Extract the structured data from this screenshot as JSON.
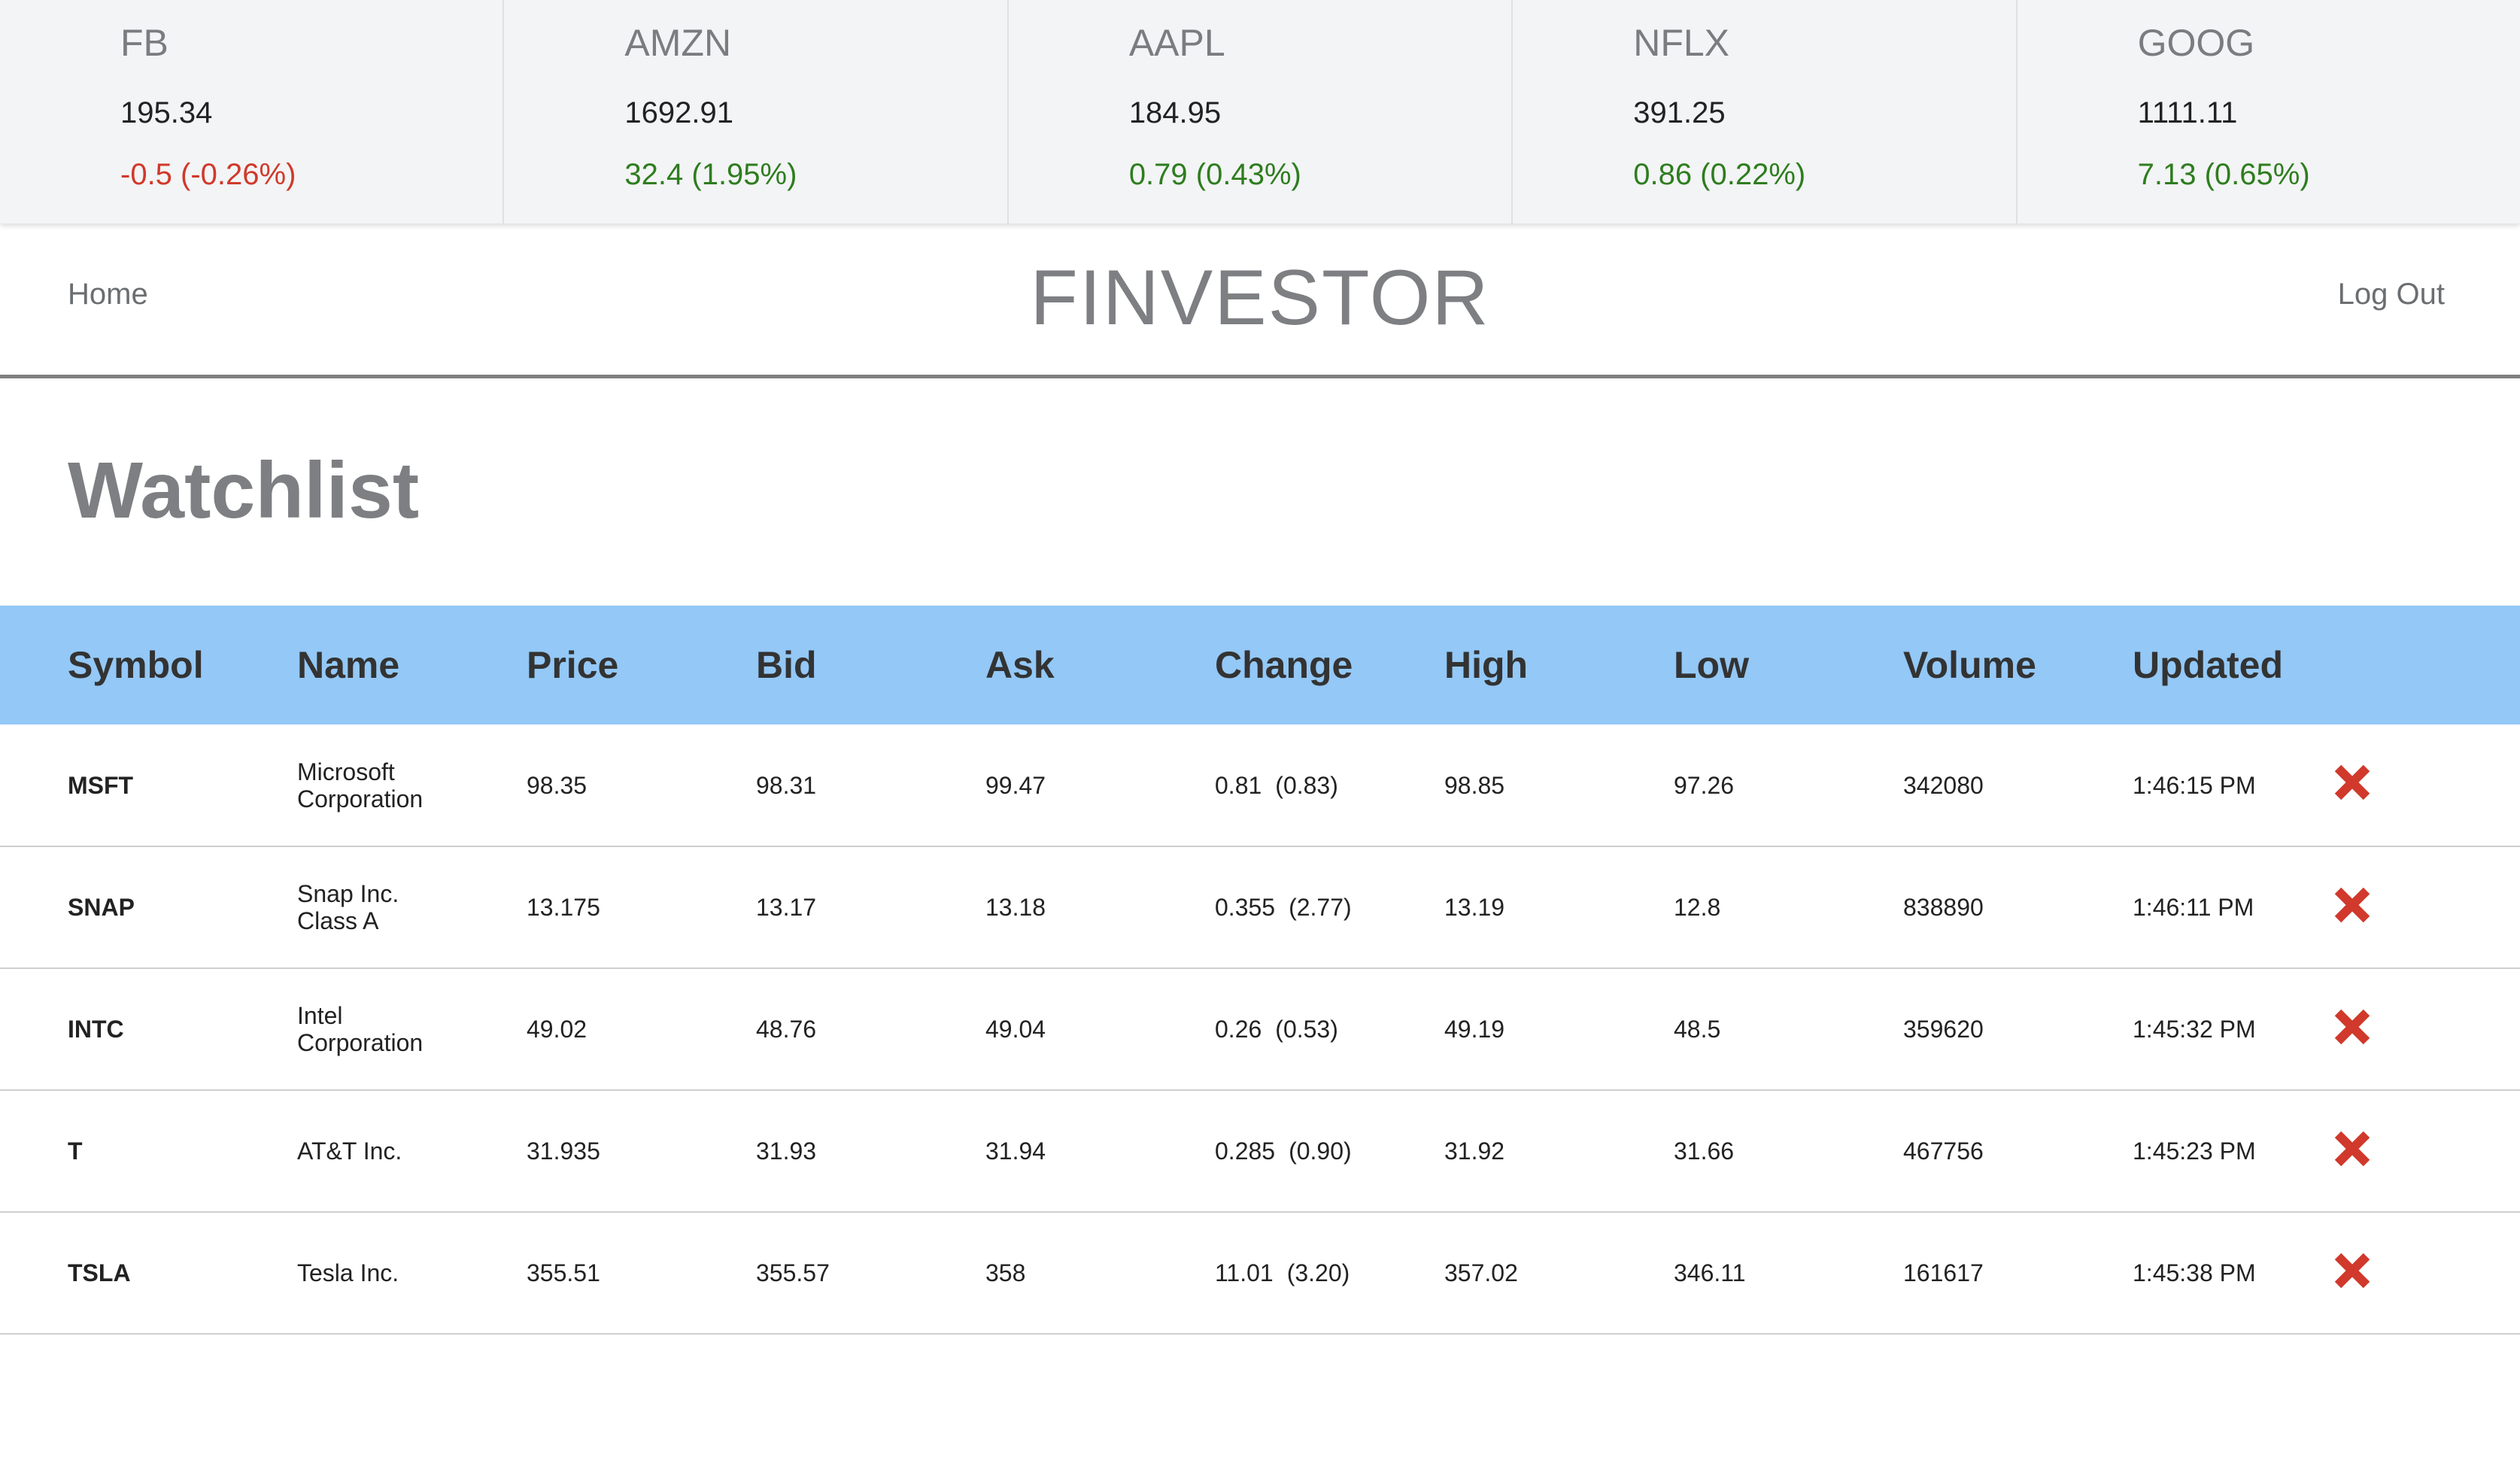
{
  "tickers": [
    {
      "symbol": "FB",
      "price": "195.34",
      "change": "-0.5 (-0.26%)",
      "direction": "down"
    },
    {
      "symbol": "AMZN",
      "price": "1692.91",
      "change": "32.4 (1.95%)",
      "direction": "up"
    },
    {
      "symbol": "AAPL",
      "price": "184.95",
      "change": "0.79 (0.43%)",
      "direction": "up"
    },
    {
      "symbol": "NFLX",
      "price": "391.25",
      "change": "0.86 (0.22%)",
      "direction": "up"
    },
    {
      "symbol": "GOOG",
      "price": "1111.11",
      "change": "7.13 (0.65%)",
      "direction": "up"
    }
  ],
  "nav": {
    "home": "Home",
    "brand": "FINVESTOR",
    "logout": "Log Out"
  },
  "page": {
    "title": "Watchlist"
  },
  "table": {
    "headers": [
      "Symbol",
      "Name",
      "Price",
      "Bid",
      "Ask",
      "Change",
      "High",
      "Low",
      "Volume",
      "Updated",
      ""
    ],
    "rows": [
      {
        "symbol": "MSFT",
        "name_line1": "Microsoft",
        "name_line2": "Corporation",
        "price": "98.35",
        "bid": "98.31",
        "ask": "99.47",
        "change": "0.81",
        "change_pct": "(0.83)",
        "high": "98.85",
        "low": "97.26",
        "volume": "342080",
        "updated": "1:46:15 PM"
      },
      {
        "symbol": "SNAP",
        "name_line1": "Snap Inc.",
        "name_line2": "Class A",
        "price": "13.175",
        "bid": "13.17",
        "ask": "13.18",
        "change": "0.355",
        "change_pct": "(2.77)",
        "high": "13.19",
        "low": "12.8",
        "volume": "838890",
        "updated": "1:46:11 PM"
      },
      {
        "symbol": "INTC",
        "name_line1": "Intel",
        "name_line2": "Corporation",
        "price": "49.02",
        "bid": "48.76",
        "ask": "49.04",
        "change": "0.26",
        "change_pct": "(0.53)",
        "high": "49.19",
        "low": "48.5",
        "volume": "359620",
        "updated": "1:45:32 PM"
      },
      {
        "symbol": "T",
        "name_line1": "AT&T Inc.",
        "name_line2": "",
        "price": "31.935",
        "bid": "31.93",
        "ask": "31.94",
        "change": "0.285",
        "change_pct": "(0.90)",
        "high": "31.92",
        "low": "31.66",
        "volume": "467756",
        "updated": "1:45:23 PM"
      },
      {
        "symbol": "TSLA",
        "name_line1": "Tesla Inc.",
        "name_line2": "",
        "price": "355.51",
        "bid": "355.57",
        "ask": "358",
        "change": "11.01",
        "change_pct": "(3.20)",
        "high": "357.02",
        "low": "346.11",
        "volume": "161617",
        "updated": "1:45:38 PM"
      }
    ]
  },
  "colors": {
    "header_bg": "#93c8f7",
    "up": "#2e7d1f",
    "down": "#d0392b",
    "delete_icon": "#d0392b"
  },
  "icons": {
    "delete": "close-x-icon"
  }
}
